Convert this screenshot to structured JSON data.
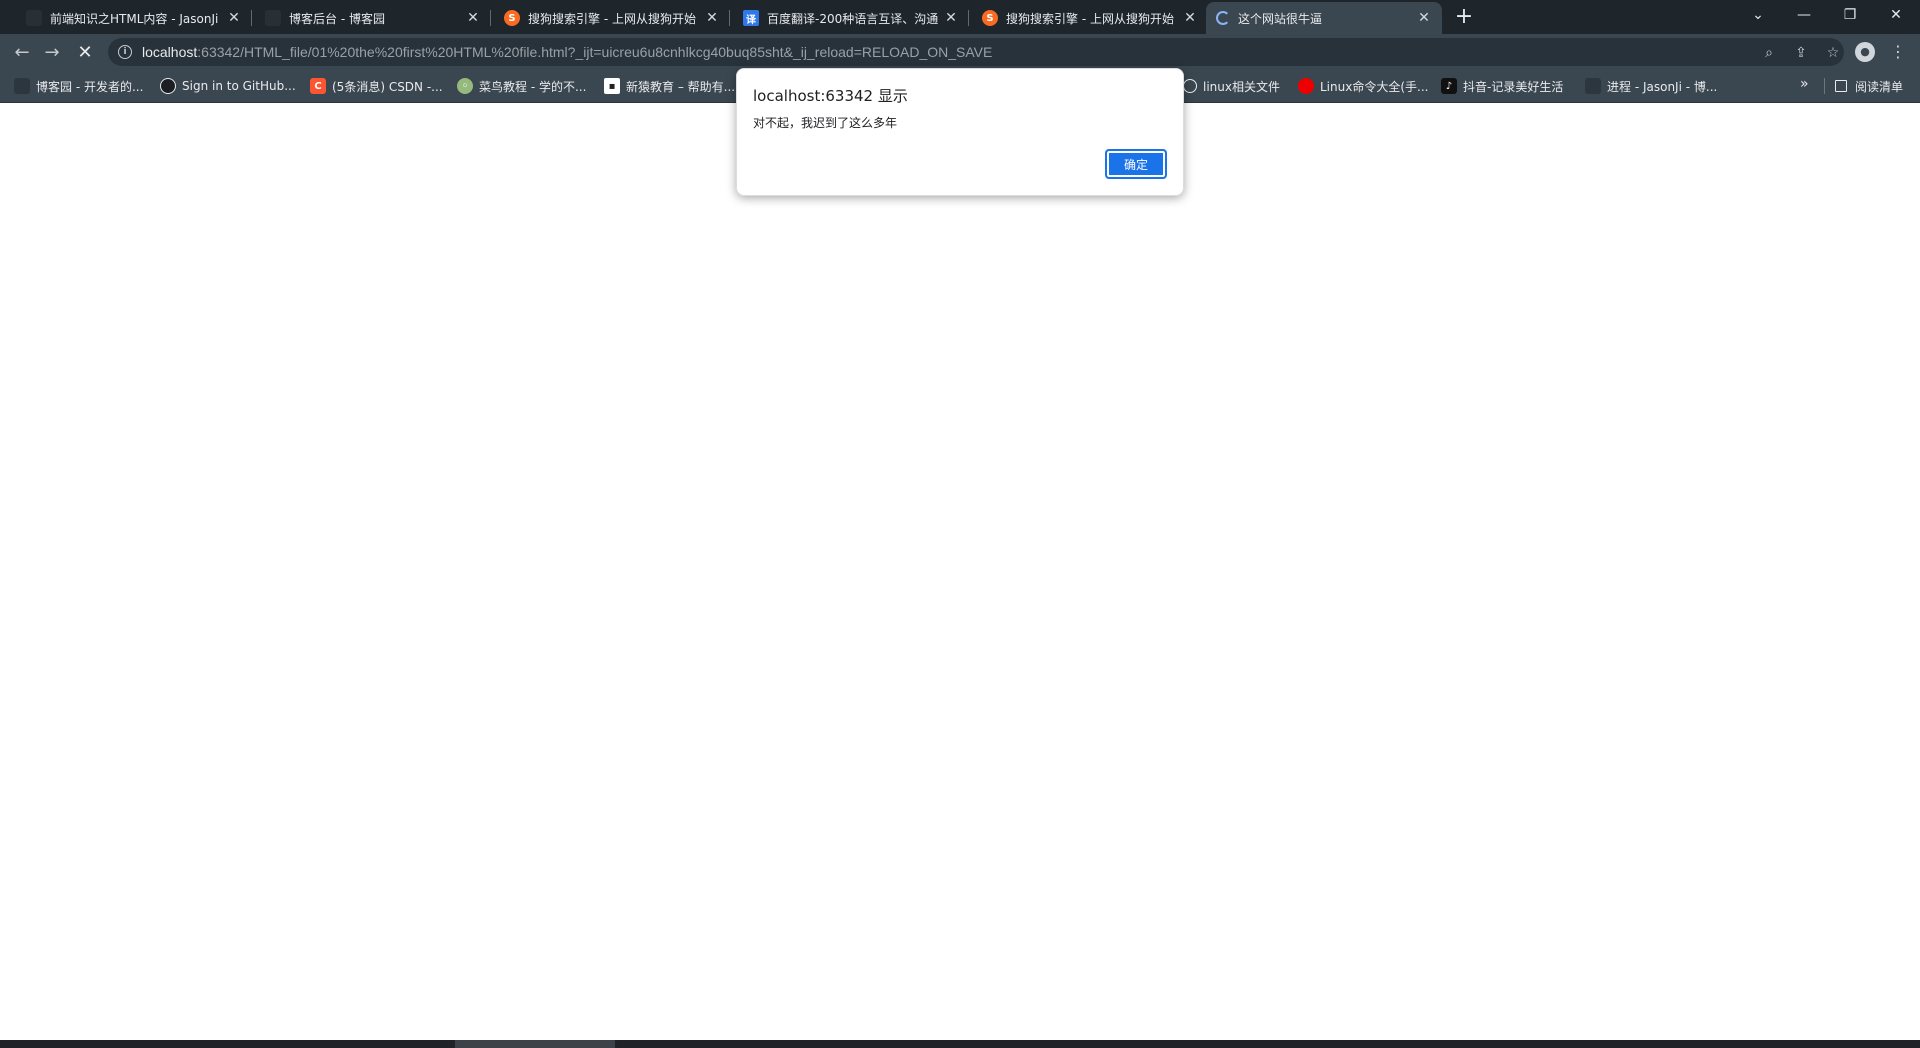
{
  "tabs": [
    {
      "title": "前端知识之HTML内容 - JasonJi",
      "favicon": "cnblogs-icon"
    },
    {
      "title": "博客后台 - 博客园",
      "favicon": "cnblogs-icon"
    },
    {
      "title": "搜狗搜索引擎 - 上网从搜狗开始",
      "favicon": "sogou-icon",
      "glyph": "S"
    },
    {
      "title": "百度翻译-200种语言互译、沟通",
      "favicon": "baidu-fanyi-icon",
      "glyph": "译"
    },
    {
      "title": "搜狗搜索引擎 - 上网从搜狗开始",
      "favicon": "sogou-icon",
      "glyph": "S"
    },
    {
      "title": "这个网站很牛逼",
      "favicon": "loading-spinner-icon",
      "active": true
    }
  ],
  "newtab_glyph": "+",
  "address": {
    "host": "localhost",
    "rest": ":63342/HTML_file/01%20the%20first%20HTML%20file.html?_ijt=uicreu6u8cnhlkcg40buq85sht&_ij_reload=RELOAD_ON_SAVE"
  },
  "bookmarks": [
    {
      "label": "博客园 - 开发者的...",
      "icon": "cnblogs-icon"
    },
    {
      "label": "Sign in to GitHub...",
      "icon": "github-icon"
    },
    {
      "label": "(5条消息) CSDN -...",
      "icon": "csdn-icon",
      "glyph": "C"
    },
    {
      "label": "菜鸟教程 - 学的不...",
      "icon": "runoob-icon"
    },
    {
      "label": "新猿教育 – 帮助有...",
      "icon": "xinmao-icon"
    },
    {
      "label": "linux相关文件",
      "icon": "globe-icon"
    },
    {
      "label": "Linux命令大全(手...",
      "icon": "redhat-icon"
    },
    {
      "label": "抖音-记录美好生活",
      "icon": "douyin-icon",
      "glyph": "♪"
    },
    {
      "label": "进程 - JasonJi - 博...",
      "icon": "cnblogs-icon"
    }
  ],
  "bookmarks_more": "»",
  "reading_list": "阅读清单",
  "dialog": {
    "title": "localhost:63342 显示",
    "message": "对不起，我迟到了这么多年",
    "ok_label": "确定"
  },
  "colors": {
    "tabstrip": "#1e262c",
    "toolbar": "#3b4750",
    "omnibox": "#28323a",
    "accent": "#1a73e8"
  }
}
